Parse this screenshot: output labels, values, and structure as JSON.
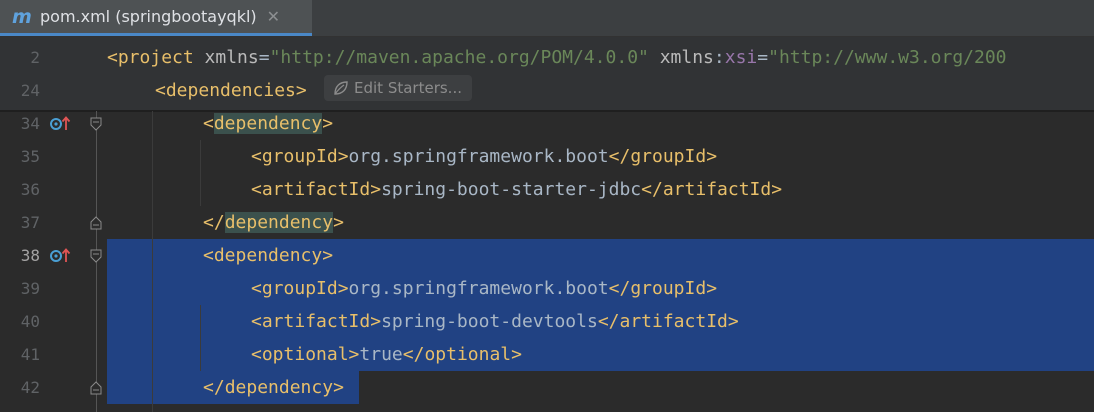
{
  "tab": {
    "icon_letter": "m",
    "title": "pom.xml (springbootayqkl)",
    "close": "✕"
  },
  "inlay": {
    "label": "Edit Starters..."
  },
  "lines": [
    {
      "num": "2",
      "indent": 0,
      "segments": [
        {
          "t": "<",
          "c": "bracket"
        },
        {
          "t": "project",
          "c": "tag"
        },
        {
          "t": " xmlns",
          "c": "attr"
        },
        {
          "t": "=",
          "c": "text"
        },
        {
          "t": "\"http://maven.apache.org/POM/4.0.0\"",
          "c": "str"
        },
        {
          "t": " xmlns",
          "c": "attr"
        },
        {
          "t": ":",
          "c": "text"
        },
        {
          "t": "xsi",
          "c": "xsi"
        },
        {
          "t": "=",
          "c": "text"
        },
        {
          "t": "\"http://www.w3.org/200",
          "c": "str"
        }
      ]
    },
    {
      "num": "24",
      "indent": 1,
      "segments": [
        {
          "t": "<",
          "c": "bracket"
        },
        {
          "t": "dependencies",
          "c": "tag"
        },
        {
          "t": ">",
          "c": "bracket"
        }
      ]
    },
    {
      "num": "34",
      "indent": 2,
      "segments": [
        {
          "t": "<",
          "c": "bracket"
        },
        {
          "t": "dependency",
          "c": "tag hl"
        },
        {
          "t": ">",
          "c": "bracket"
        }
      ]
    },
    {
      "num": "35",
      "indent": 3,
      "segments": [
        {
          "t": "<",
          "c": "bracket"
        },
        {
          "t": "groupId",
          "c": "tag"
        },
        {
          "t": ">",
          "c": "bracket"
        },
        {
          "t": "org.springframework.boot",
          "c": "text"
        },
        {
          "t": "</",
          "c": "bracket"
        },
        {
          "t": "groupId",
          "c": "tag"
        },
        {
          "t": ">",
          "c": "bracket"
        }
      ]
    },
    {
      "num": "36",
      "indent": 3,
      "segments": [
        {
          "t": "<",
          "c": "bracket"
        },
        {
          "t": "artifactId",
          "c": "tag"
        },
        {
          "t": ">",
          "c": "bracket"
        },
        {
          "t": "spring-boot-starter-jdbc",
          "c": "text"
        },
        {
          "t": "</",
          "c": "bracket"
        },
        {
          "t": "artifactId",
          "c": "tag"
        },
        {
          "t": ">",
          "c": "bracket"
        }
      ]
    },
    {
      "num": "37",
      "indent": 2,
      "segments": [
        {
          "t": "</",
          "c": "bracket"
        },
        {
          "t": "dependency",
          "c": "tag hl"
        },
        {
          "t": ">",
          "c": "bracket"
        }
      ]
    },
    {
      "num": "38",
      "indent": 2,
      "segments": [
        {
          "t": "<",
          "c": "bracket"
        },
        {
          "t": "dependency",
          "c": "tag"
        },
        {
          "t": ">",
          "c": "bracket"
        }
      ]
    },
    {
      "num": "39",
      "indent": 3,
      "segments": [
        {
          "t": "<",
          "c": "bracket"
        },
        {
          "t": "groupId",
          "c": "tag"
        },
        {
          "t": ">",
          "c": "bracket"
        },
        {
          "t": "org.springframework.boot",
          "c": "text"
        },
        {
          "t": "</",
          "c": "bracket"
        },
        {
          "t": "groupId",
          "c": "tag"
        },
        {
          "t": ">",
          "c": "bracket"
        }
      ]
    },
    {
      "num": "40",
      "indent": 3,
      "segments": [
        {
          "t": "<",
          "c": "bracket"
        },
        {
          "t": "artifactId",
          "c": "tag"
        },
        {
          "t": ">",
          "c": "bracket"
        },
        {
          "t": "spring-boot-devtools",
          "c": "text"
        },
        {
          "t": "</",
          "c": "bracket"
        },
        {
          "t": "artifactId",
          "c": "tag"
        },
        {
          "t": ">",
          "c": "bracket"
        }
      ]
    },
    {
      "num": "41",
      "indent": 3,
      "segments": [
        {
          "t": "<",
          "c": "bracket"
        },
        {
          "t": "optional",
          "c": "tag"
        },
        {
          "t": ">",
          "c": "bracket"
        },
        {
          "t": "true",
          "c": "text"
        },
        {
          "t": "</",
          "c": "bracket"
        },
        {
          "t": "optional",
          "c": "tag"
        },
        {
          "t": ">",
          "c": "bracket"
        }
      ]
    },
    {
      "num": "42",
      "indent": 2,
      "segments": [
        {
          "t": "</",
          "c": "bracket"
        },
        {
          "t": "dependency",
          "c": "tag"
        },
        {
          "t": ">",
          "c": "bracket"
        }
      ]
    }
  ],
  "current_line": "38",
  "colors": {
    "background": "#2b2b2b",
    "selection": "#214283",
    "tag": "#e8bf6a",
    "string": "#6a8759",
    "attribute": "#bababa",
    "namespace": "#9876aa",
    "text": "#a9b7c6",
    "line_number": "#606366"
  }
}
